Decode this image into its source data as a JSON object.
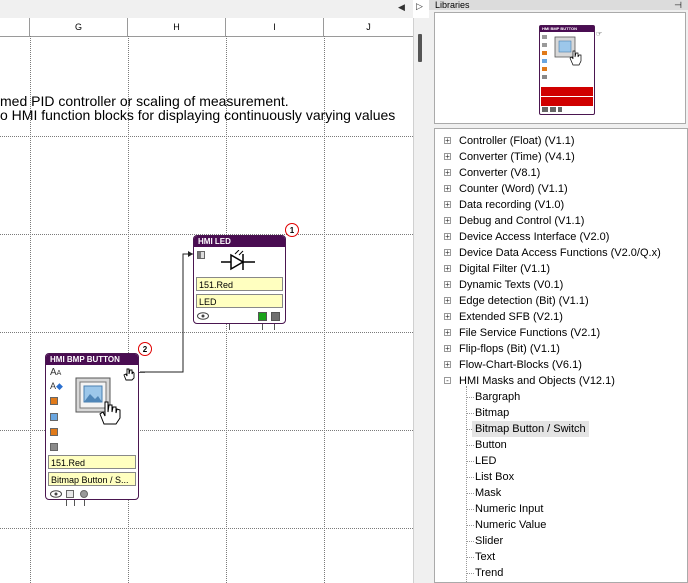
{
  "canvas": {
    "columns": [
      "G",
      "H",
      "I",
      "J"
    ],
    "description_lines": [
      "med PID controller or scaling of measurement.",
      "o HMI function blocks for displaying continuously varying values"
    ]
  },
  "blocks": {
    "led": {
      "title": "HMI LED",
      "badge": "1",
      "fields": [
        "151.Red",
        "LED"
      ],
      "icon": "led-diode-icon"
    },
    "button": {
      "title": "HMI BMP BUTTON",
      "badge": "2",
      "fields": [
        "151.Red",
        "Bitmap Button / S..."
      ],
      "icon": "bitmap-hand-icon"
    }
  },
  "panel": {
    "title": "Libraries",
    "pin_icon": "pin-icon",
    "preview_title": "HMI BMP BUTTON",
    "tree": [
      {
        "label": "Controller (Float) (V1.1)",
        "expander": "+"
      },
      {
        "label": "Converter (Time) (V4.1)",
        "expander": "+"
      },
      {
        "label": "Converter (V8.1)",
        "expander": "+"
      },
      {
        "label": "Counter (Word) (V1.1)",
        "expander": "+"
      },
      {
        "label": "Data recording (V1.0)",
        "expander": "+"
      },
      {
        "label": "Debug and Control (V1.1)",
        "expander": "+"
      },
      {
        "label": "Device Access Interface (V2.0)",
        "expander": "+"
      },
      {
        "label": "Device Data Access Functions (V2.0/Q.x)",
        "expander": "+"
      },
      {
        "label": "Digital Filter (V1.1)",
        "expander": "+"
      },
      {
        "label": "Dynamic Texts (V0.1)",
        "expander": "+"
      },
      {
        "label": "Edge detection (Bit) (V1.1)",
        "expander": "+"
      },
      {
        "label": "Extended SFB (V2.1)",
        "expander": "+"
      },
      {
        "label": "File Service Functions (V2.1)",
        "expander": "+"
      },
      {
        "label": "Flip-flops (Bit) (V1.1)",
        "expander": "+"
      },
      {
        "label": "Flow-Chart-Blocks (V6.1)",
        "expander": "+"
      },
      {
        "label": "HMI Masks and Objects (V12.1)",
        "expander": "-"
      }
    ],
    "children": [
      "Bargraph",
      "Bitmap",
      "Bitmap Button / Switch",
      "Button",
      "LED",
      "List Box",
      "Mask",
      "Numeric Input",
      "Numeric Value",
      "Slider",
      "Text",
      "Trend"
    ],
    "selected_child": "Bitmap Button / Switch"
  },
  "colors": {
    "block_title": "#4a0d52",
    "field_bg": "#ffffc0",
    "badge_ring": "#e00000",
    "output_green": "#1aa31a"
  }
}
